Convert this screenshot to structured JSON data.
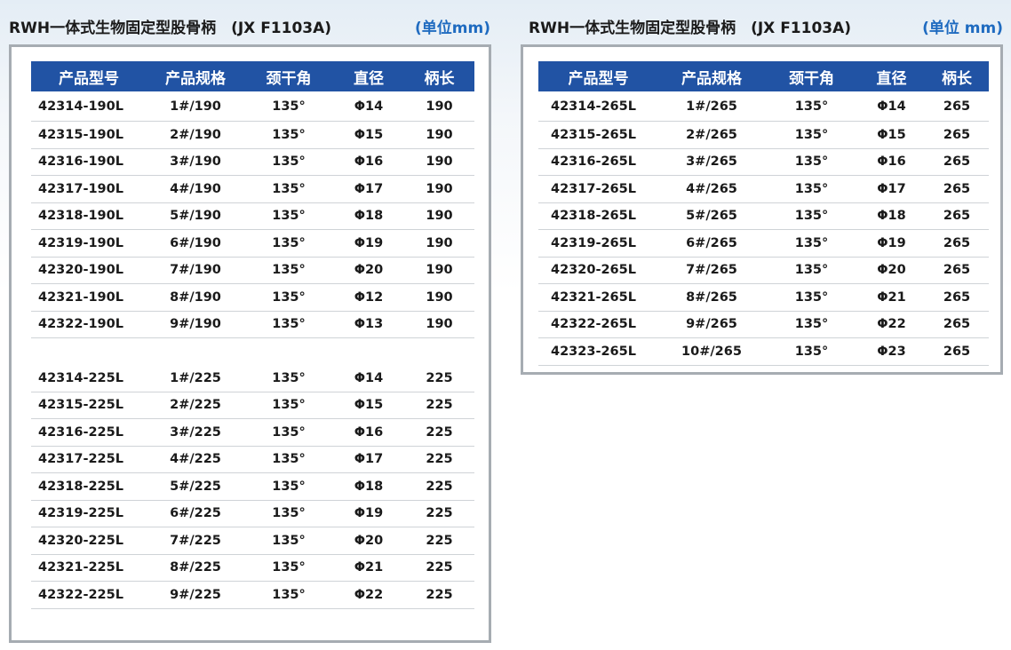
{
  "left": {
    "title": "RWH一体式生物固定型股骨柄　(JX F1103A)",
    "unit": "(单位mm)",
    "headers": [
      "产品型号",
      "产品规格",
      "颈干角",
      "直径",
      "柄长"
    ],
    "groups": [
      [
        [
          "42314-190L",
          "1#/190",
          "135°",
          "Φ14",
          "190"
        ],
        [
          "42315-190L",
          "2#/190",
          "135°",
          "Φ15",
          "190"
        ],
        [
          "42316-190L",
          "3#/190",
          "135°",
          "Φ16",
          "190"
        ],
        [
          "42317-190L",
          "4#/190",
          "135°",
          "Φ17",
          "190"
        ],
        [
          "42318-190L",
          "5#/190",
          "135°",
          "Φ18",
          "190"
        ],
        [
          "42319-190L",
          "6#/190",
          "135°",
          "Φ19",
          "190"
        ],
        [
          "42320-190L",
          "7#/190",
          "135°",
          "Φ20",
          "190"
        ],
        [
          "42321-190L",
          "8#/190",
          "135°",
          "Φ12",
          "190"
        ],
        [
          "42322-190L",
          "9#/190",
          "135°",
          "Φ13",
          "190"
        ]
      ],
      [
        [
          "42314-225L",
          "1#/225",
          "135°",
          "Φ14",
          "225"
        ],
        [
          "42315-225L",
          "2#/225",
          "135°",
          "Φ15",
          "225"
        ],
        [
          "42316-225L",
          "3#/225",
          "135°",
          "Φ16",
          "225"
        ],
        [
          "42317-225L",
          "4#/225",
          "135°",
          "Φ17",
          "225"
        ],
        [
          "42318-225L",
          "5#/225",
          "135°",
          "Φ18",
          "225"
        ],
        [
          "42319-225L",
          "6#/225",
          "135°",
          "Φ19",
          "225"
        ],
        [
          "42320-225L",
          "7#/225",
          "135°",
          "Φ20",
          "225"
        ],
        [
          "42321-225L",
          "8#/225",
          "135°",
          "Φ21",
          "225"
        ],
        [
          "42322-225L",
          "9#/225",
          "135°",
          "Φ22",
          "225"
        ]
      ]
    ]
  },
  "right": {
    "title": "RWH一体式生物固定型股骨柄　(JX F1103A)",
    "unit": "(单位 mm)",
    "headers": [
      "产品型号",
      "产品规格",
      "颈干角",
      "直径",
      "柄长"
    ],
    "groups": [
      [
        [
          "42314-265L",
          "1#/265",
          "135°",
          "Φ14",
          "265"
        ],
        [
          "42315-265L",
          "2#/265",
          "135°",
          "Φ15",
          "265"
        ],
        [
          "42316-265L",
          "3#/265",
          "135°",
          "Φ16",
          "265"
        ],
        [
          "42317-265L",
          "4#/265",
          "135°",
          "Φ17",
          "265"
        ],
        [
          "42318-265L",
          "5#/265",
          "135°",
          "Φ18",
          "265"
        ],
        [
          "42319-265L",
          "6#/265",
          "135°",
          "Φ19",
          "265"
        ],
        [
          "42320-265L",
          "7#/265",
          "135°",
          "Φ20",
          "265"
        ],
        [
          "42321-265L",
          "8#/265",
          "135°",
          "Φ21",
          "265"
        ],
        [
          "42322-265L",
          "9#/265",
          "135°",
          "Φ22",
          "265"
        ],
        [
          "42323-265L",
          "10#/265",
          "135°",
          "Φ23",
          "265"
        ]
      ]
    ]
  }
}
